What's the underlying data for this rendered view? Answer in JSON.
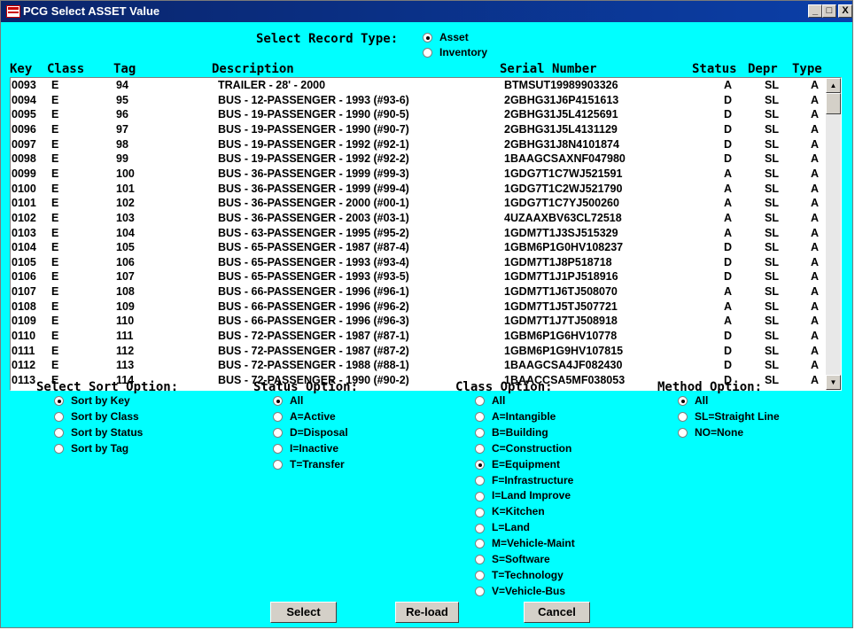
{
  "window": {
    "title": "PCG Select ASSET Value",
    "min": "_",
    "max": "□",
    "close": "X"
  },
  "record_type": {
    "label": "Select Record Type:",
    "options": [
      {
        "label": "Asset",
        "selected": true
      },
      {
        "label": "Inventory",
        "selected": false
      }
    ]
  },
  "columns": [
    "Key",
    "Class",
    "Tag",
    "Description",
    "Serial Number",
    "Status",
    "Depr",
    "Type"
  ],
  "rows": [
    [
      "0093",
      "E",
      "94",
      "TRAILER - 28' - 2000",
      "BTMSUT19989903326",
      "A",
      "SL",
      "A"
    ],
    [
      "0094",
      "E",
      "95",
      "BUS - 12-PASSENGER - 1993 (#93-6)",
      "2GBHG31J6P4151613",
      "D",
      "SL",
      "A"
    ],
    [
      "0095",
      "E",
      "96",
      "BUS - 19-PASSENGER - 1990 (#90-5)",
      "2GBHG31J5L4125691",
      "D",
      "SL",
      "A"
    ],
    [
      "0096",
      "E",
      "97",
      "BUS - 19-PASSENGER - 1990 (#90-7)",
      "2GBHG31J5L4131129",
      "D",
      "SL",
      "A"
    ],
    [
      "0097",
      "E",
      "98",
      "BUS - 19-PASSENGER - 1992 (#92-1)",
      "2GBHG31J8N4101874",
      "D",
      "SL",
      "A"
    ],
    [
      "0098",
      "E",
      "99",
      "BUS - 19-PASSENGER - 1992 (#92-2)",
      "1BAAGCSAXNF047980",
      "D",
      "SL",
      "A"
    ],
    [
      "0099",
      "E",
      "100",
      "BUS - 36-PASSENGER - 1999 (#99-3)",
      "1GDG7T1C7WJ521591",
      "A",
      "SL",
      "A"
    ],
    [
      "0100",
      "E",
      "101",
      "BUS - 36-PASSENGER - 1999 (#99-4)",
      "1GDG7T1C2WJ521790",
      "A",
      "SL",
      "A"
    ],
    [
      "0101",
      "E",
      "102",
      "BUS - 36-PASSENGER - 2000 (#00-1)",
      "1GDG7T1C7YJ500260",
      "A",
      "SL",
      "A"
    ],
    [
      "0102",
      "E",
      "103",
      "BUS - 36-PASSENGER - 2003 (#03-1)",
      "4UZAAXBV63CL72518",
      "A",
      "SL",
      "A"
    ],
    [
      "0103",
      "E",
      "104",
      "BUS - 63-PASSENGER - 1995 (#95-2)",
      "1GDM7T1J3SJ515329",
      "A",
      "SL",
      "A"
    ],
    [
      "0104",
      "E",
      "105",
      "BUS - 65-PASSENGER - 1987 (#87-4)",
      "1GBM6P1G0HV108237",
      "D",
      "SL",
      "A"
    ],
    [
      "0105",
      "E",
      "106",
      "BUS - 65-PASSENGER - 1993 (#93-4)",
      "1GDM7T1J8P518718",
      "D",
      "SL",
      "A"
    ],
    [
      "0106",
      "E",
      "107",
      "BUS - 65-PASSENGER - 1993 (#93-5)",
      "1GDM7T1J1PJ518916",
      "D",
      "SL",
      "A"
    ],
    [
      "0107",
      "E",
      "108",
      "BUS - 66-PASSENGER - 1996 (#96-1)",
      "1GDM7T1J6TJ508070",
      "A",
      "SL",
      "A"
    ],
    [
      "0108",
      "E",
      "109",
      "BUS - 66-PASSENGER - 1996 (#96-2)",
      "1GDM7T1J5TJ507721",
      "A",
      "SL",
      "A"
    ],
    [
      "0109",
      "E",
      "110",
      "BUS - 66-PASSENGER - 1996 (#96-3)",
      "1GDM7T1J7TJ508918",
      "A",
      "SL",
      "A"
    ],
    [
      "0110",
      "E",
      "111",
      "BUS - 72-PASSENGER - 1987 (#87-1)",
      "1GBM6P1G6HV10778",
      "D",
      "SL",
      "A"
    ],
    [
      "0111",
      "E",
      "112",
      "BUS - 72-PASSENGER - 1987 (#87-2)",
      "1GBM6P1G9HV107815",
      "D",
      "SL",
      "A"
    ],
    [
      "0112",
      "E",
      "113",
      "BUS - 72-PASSENGER - 1988 (#88-1)",
      "1BAAGCSA4JF082430",
      "D",
      "SL",
      "A"
    ],
    [
      "0113",
      "E",
      "114",
      "BUS - 72-PASSENGER - 1990 (#90-2)",
      "1BAACCSA5MF038053",
      "D",
      "SL",
      "A"
    ]
  ],
  "sort": {
    "label": "Select Sort Option:",
    "options": [
      {
        "label": "Sort by Key",
        "selected": true
      },
      {
        "label": "Sort by Class",
        "selected": false
      },
      {
        "label": "Sort by Status",
        "selected": false
      },
      {
        "label": "Sort by Tag",
        "selected": false
      }
    ]
  },
  "status": {
    "label": "Status Option:",
    "options": [
      {
        "label": "All",
        "selected": true
      },
      {
        "label": "A=Active",
        "selected": false
      },
      {
        "label": "D=Disposal",
        "selected": false
      },
      {
        "label": "I=Inactive",
        "selected": false
      },
      {
        "label": "T=Transfer",
        "selected": false
      }
    ]
  },
  "class": {
    "label": "Class Option:",
    "options": [
      {
        "label": "All",
        "selected": false
      },
      {
        "label": "A=Intangible",
        "selected": false
      },
      {
        "label": "B=Building",
        "selected": false
      },
      {
        "label": "C=Construction",
        "selected": false
      },
      {
        "label": "E=Equipment",
        "selected": true
      },
      {
        "label": "F=Infrastructure",
        "selected": false
      },
      {
        "label": "I=Land Improve",
        "selected": false
      },
      {
        "label": "K=Kitchen",
        "selected": false
      },
      {
        "label": "L=Land",
        "selected": false
      },
      {
        "label": "M=Vehicle-Maint",
        "selected": false
      },
      {
        "label": "S=Software",
        "selected": false
      },
      {
        "label": "T=Technology",
        "selected": false
      },
      {
        "label": "V=Vehicle-Bus",
        "selected": false
      }
    ]
  },
  "method": {
    "label": "Method Option:",
    "options": [
      {
        "label": "All",
        "selected": true
      },
      {
        "label": "SL=Straight Line",
        "selected": false
      },
      {
        "label": "NO=None",
        "selected": false
      }
    ]
  },
  "buttons": {
    "select": "Select",
    "reload": "Re-load",
    "cancel": "Cancel"
  },
  "colors": {
    "background": "#00ffff",
    "titlebar": "#0a246a",
    "button_face": "#d4d0c8"
  }
}
